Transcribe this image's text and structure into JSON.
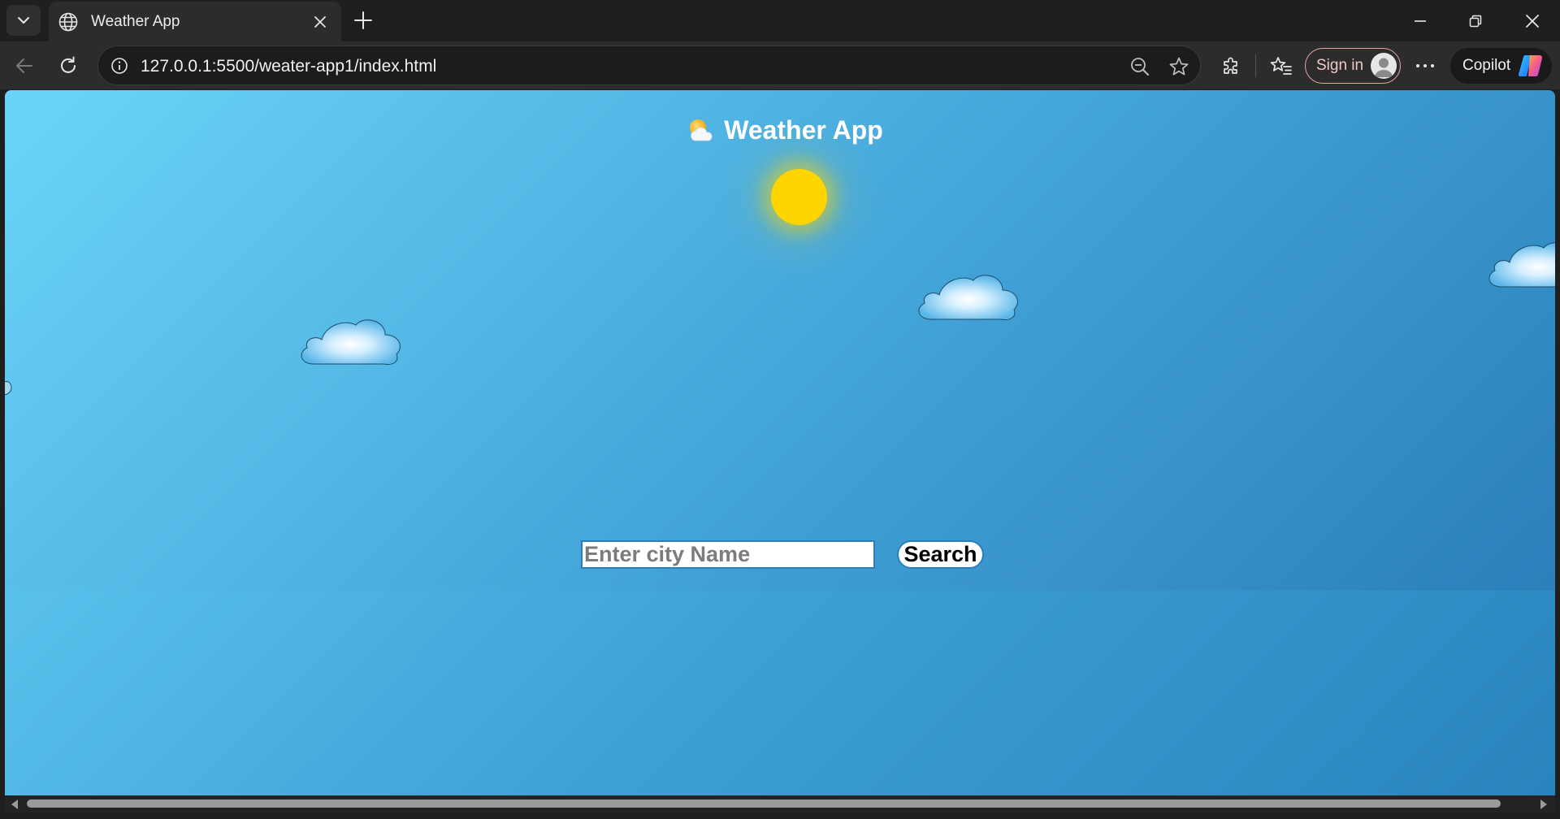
{
  "browser": {
    "tab_title": "Weather App",
    "url": "127.0.0.1:5500/weater-app1/index.html",
    "sign_in_label": "Sign in",
    "copilot_label": "Copilot"
  },
  "page": {
    "title": "Weather App",
    "search": {
      "placeholder": "Enter city Name",
      "value": "",
      "button_label": "Search"
    }
  },
  "colors": {
    "sky_top": "#6bd5f9",
    "sky_bottom": "#2b80ba",
    "sun": "#ffd500"
  },
  "icons": [
    "tab-list-icon",
    "globe-icon",
    "close-icon",
    "plus-icon",
    "minimize-icon",
    "restore-icon",
    "back-icon",
    "refresh-icon",
    "info-icon",
    "zoom-out-icon",
    "star-icon",
    "extensions-icon",
    "favorites-icon",
    "more-icon",
    "copilot-icon",
    "sun-cloud-icon"
  ]
}
